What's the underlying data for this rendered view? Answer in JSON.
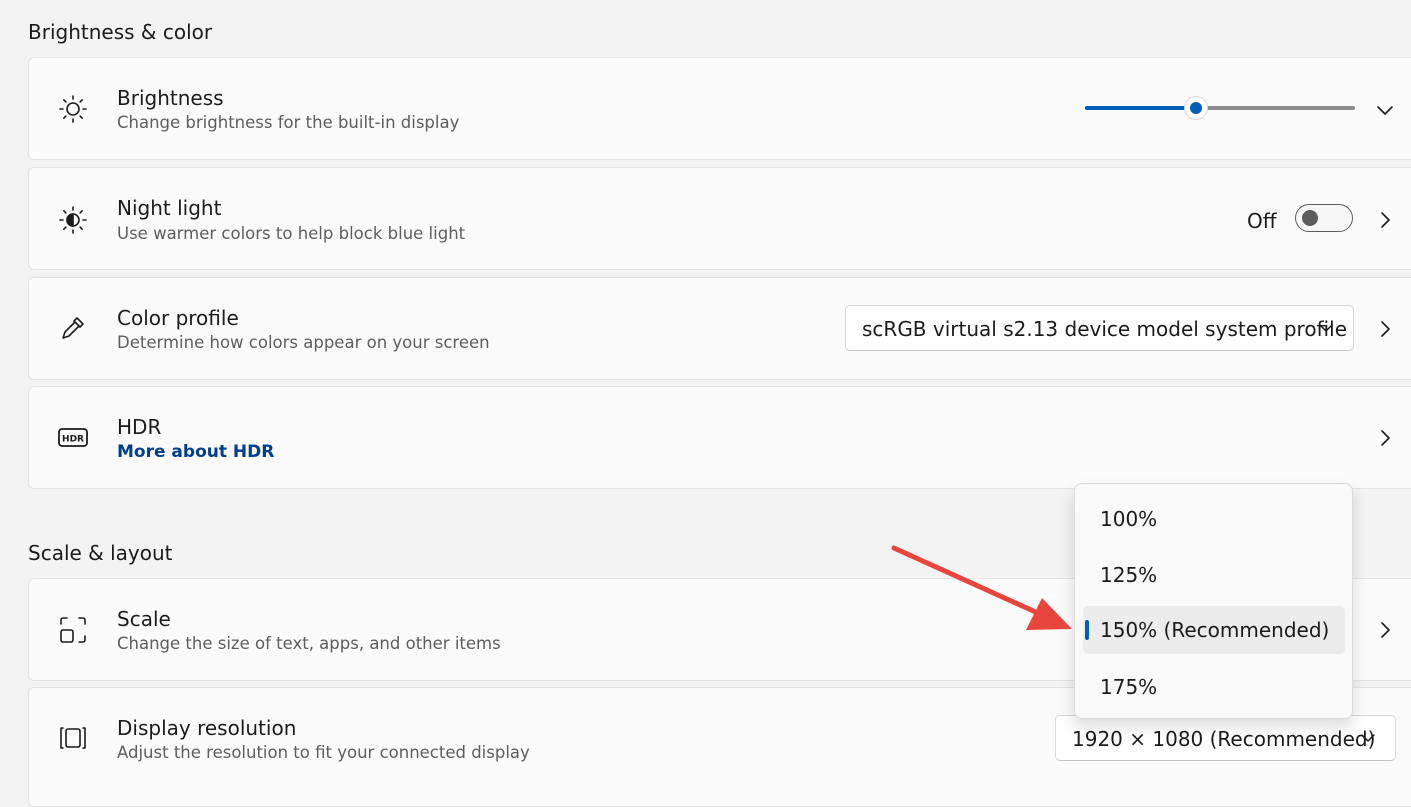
{
  "sections": {
    "brightness_color": "Brightness & color",
    "scale_layout": "Scale & layout"
  },
  "brightness": {
    "title": "Brightness",
    "subtitle": "Change brightness for the built-in display",
    "level": 0.41,
    "icon": "sun-icon"
  },
  "night_light": {
    "title": "Night light",
    "subtitle": "Use warmer colors to help block blue light",
    "state_label": "Off",
    "on": false,
    "icon": "night-light-icon"
  },
  "color_profile": {
    "title": "Color profile",
    "subtitle": "Determine how colors appear on your screen",
    "selected": "scRGB virtual s2.13 device model system profile",
    "icon": "eyedropper-icon"
  },
  "hdr": {
    "title": "HDR",
    "link": "More about HDR",
    "icon": "hdr-icon"
  },
  "scale": {
    "title": "Scale",
    "subtitle": "Change the size of text, apps, and other items",
    "icon": "scale-icon",
    "options": [
      "100%",
      "125%",
      "150% (Recommended)",
      "175%"
    ],
    "selected_index": 2
  },
  "display_resolution": {
    "title": "Display resolution",
    "subtitle": "Adjust the resolution to fit your connected display",
    "selected": "1920 × 1080 (Recommended)",
    "icon": "resolution-icon"
  },
  "colors": {
    "accent": "#005fb8",
    "link": "#003e92",
    "annotation_arrow": "#e8453c"
  }
}
